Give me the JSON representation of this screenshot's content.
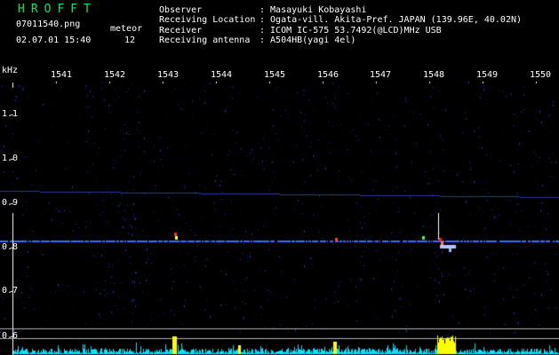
{
  "header": {
    "logo": "HROFFT",
    "filename": "07011540.png",
    "datetime": "02.07.01 15:40",
    "meteor_label": "meteor",
    "meteor_count": "12",
    "info": [
      {
        "label": "Observer",
        "value": ": Masayuki Kobayashi"
      },
      {
        "label": "Receiving Location",
        "value": ": Ogata-vill. Akita-Pref. JAPAN (139.96E, 40.02N)"
      },
      {
        "label": "Receiver",
        "value": ": ICOM IC-575 53.7492(@LCD)MHz USB"
      },
      {
        "label": "Receiving antenna",
        "value": ": A504HB(yagi 4el)"
      }
    ]
  },
  "axes": {
    "y_unit": "kHz",
    "y_ticks": [
      "1.1",
      "1.0",
      "0.9",
      "0.8",
      "0.7",
      "0.6"
    ],
    "x_ticks": [
      "1541",
      "1542",
      "1543",
      "1544",
      "1545",
      "1546",
      "1547",
      "1548",
      "1549",
      "1550"
    ]
  },
  "colors": {
    "background": "#000000",
    "text": "#ffffff",
    "logo": "#00e676",
    "noise": "#2a3cff",
    "carrier": "#3a6cff",
    "spectrum": "#00e5ff",
    "spectrum_peak": "#ffff00"
  }
}
